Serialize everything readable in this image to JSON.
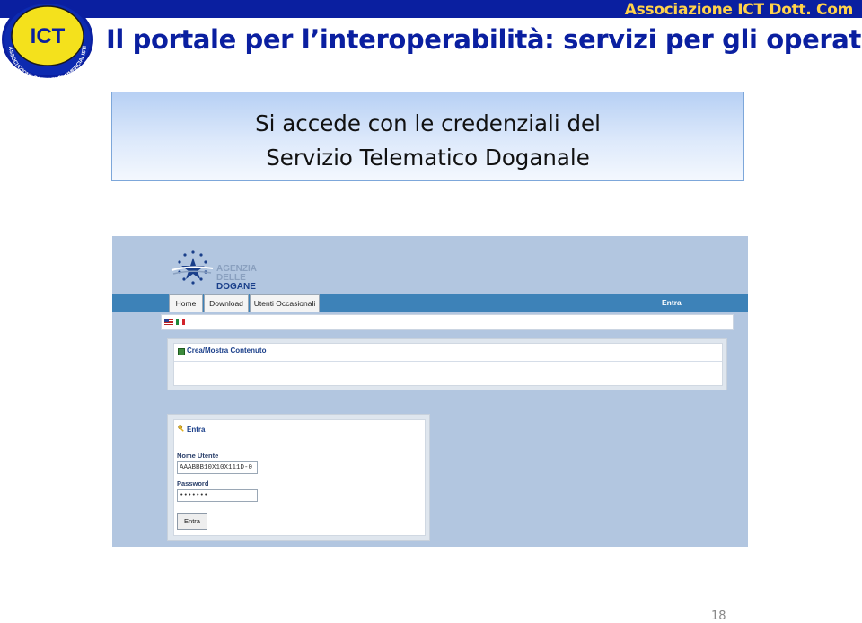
{
  "header": {
    "association": "Associazione ICT Dott. Com",
    "logo_text": "ICT",
    "logo_ring_text": "ASSOCIAZIONE DOTTORI COMMERCIALISTI • Information & Communication Technology"
  },
  "slide": {
    "title": "Il portale per l’interoperabilità: servizi per gli operatori",
    "callout_line1": "Si accede con le credenziali del",
    "callout_line2": "Servizio Telematico Doganale",
    "page_number": "18"
  },
  "screenshot": {
    "agency": {
      "line1": "AGENZIA",
      "line2": "DELLE",
      "line3": "DOGANE"
    },
    "nav": {
      "home": "Home",
      "download": "Download",
      "utenti": "Utenti Occasionali",
      "entra": "Entra"
    },
    "languages": [
      "English",
      "Italiano"
    ],
    "content_panel_title": "Crea/Mostra Contenuto",
    "login": {
      "title": "Entra",
      "username_label": "Nome Utente",
      "username_value": "AAABBB10X10X111D-0",
      "password_label": "Password",
      "password_value": "•••••••",
      "button": "Entra"
    }
  },
  "colors": {
    "header_blue": "#0a1fa0",
    "header_text": "#ffd24a",
    "callout_top": "#b7d0f4",
    "screenshot_bg": "#b2c6e0",
    "nav_bar": "#3d82b8"
  }
}
